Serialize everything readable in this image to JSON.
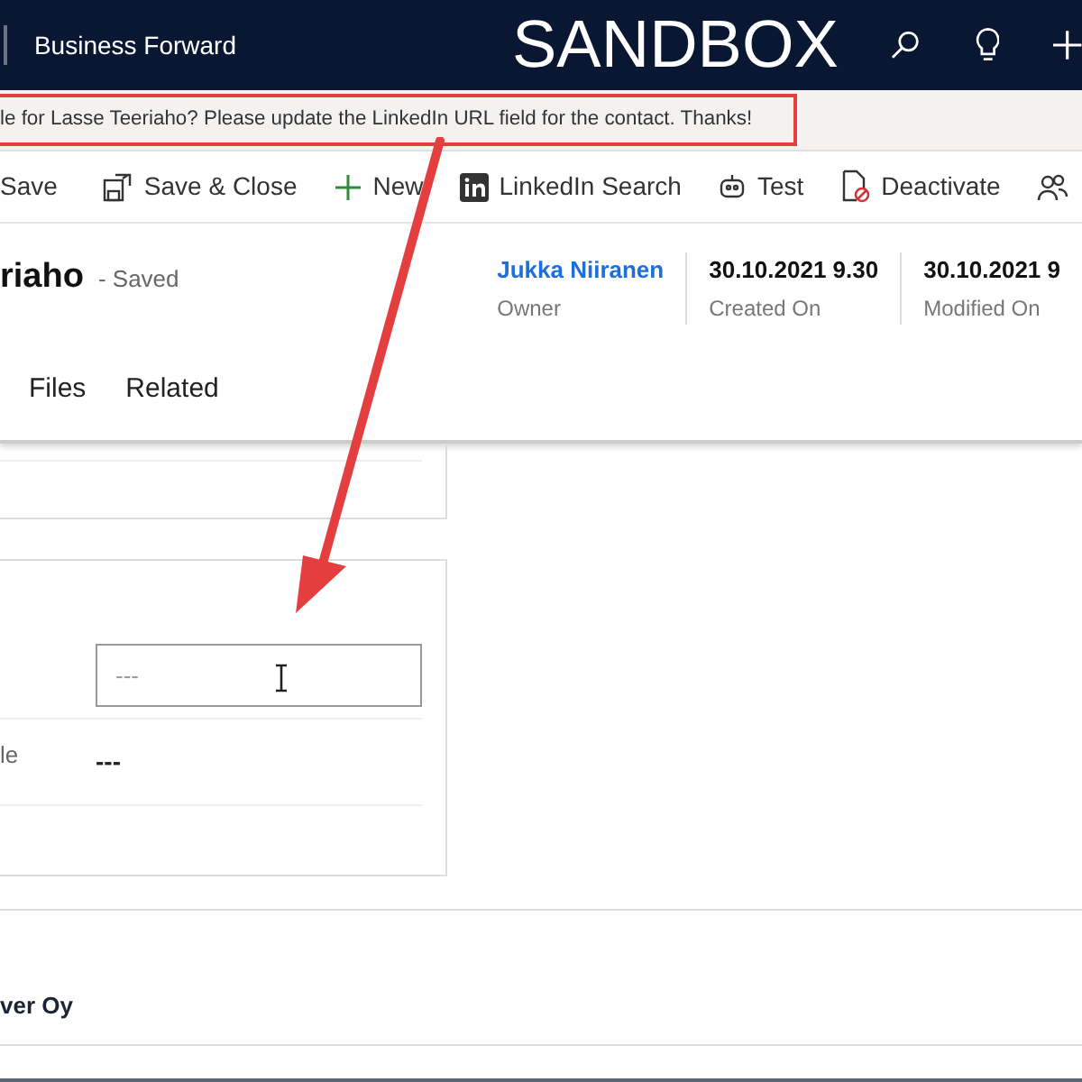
{
  "top_bar": {
    "app_name": "Business Forward",
    "environment": "SANDBOX"
  },
  "notification": {
    "text": "le for Lasse Teeriaho? Please update the LinkedIn URL field for the contact. Thanks!"
  },
  "commands": [
    {
      "kind": "save",
      "label": "Save"
    },
    {
      "kind": "save_close",
      "label": "Save & Close"
    },
    {
      "kind": "new",
      "label": "New"
    },
    {
      "kind": "linkedin",
      "label": "LinkedIn Search"
    },
    {
      "kind": "test",
      "label": "Test"
    },
    {
      "kind": "deactivate",
      "label": "Deactivate"
    },
    {
      "kind": "people"
    }
  ],
  "header": {
    "title": "riaho",
    "status": "- Saved",
    "fields": [
      {
        "kind": "link",
        "value": "Jukka Niiranen",
        "label": "Owner"
      },
      {
        "kind": "text",
        "value": "30.10.2021 9.30",
        "label": "Created On"
      },
      {
        "kind": "text",
        "value": "30.10.2021 9",
        "label": "Modified On"
      }
    ]
  },
  "tabs": [
    {
      "label": "Files"
    },
    {
      "label": "Related"
    }
  ],
  "form": {
    "linkedin_field": {
      "placeholder": "---"
    },
    "field_2": {
      "label": "le",
      "value": "---"
    }
  },
  "account": {
    "name": "ver Oy"
  }
}
